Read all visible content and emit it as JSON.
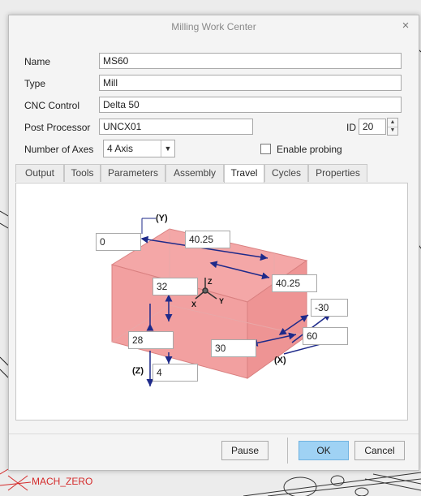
{
  "background": {
    "label": "MACH_ZERO"
  },
  "dialog": {
    "title": "Milling Work Center",
    "close": "×",
    "fields": {
      "name_label": "Name",
      "name_value": "MS60",
      "type_label": "Type",
      "type_value": "Mill",
      "cnc_label": "CNC Control",
      "cnc_value": "Delta 50",
      "post_label": "Post Processor",
      "post_value": "UNCX01",
      "id_label": "ID",
      "id_value": "20",
      "axes_label": "Number of Axes",
      "axes_value": "4 Axis",
      "probing_label": "Enable probing"
    },
    "tabs": [
      "Output",
      "Tools",
      "Parameters",
      "Assembly",
      "Travel",
      "Cycles",
      "Properties"
    ],
    "active_tab": "Travel",
    "travel": {
      "values": {
        "y_min": "0",
        "y_len": "40.25",
        "y_max": "40.25",
        "z_max": "32",
        "z_min_a": "28",
        "z_min_b": "4",
        "x_min": "-30",
        "x_max": "60",
        "x_len": "30"
      },
      "axis_labels": {
        "y": "(Y)",
        "z": "(Z)",
        "x": "(X)"
      },
      "triad": {
        "z": "Z",
        "x": "X",
        "y": "Y"
      }
    },
    "buttons": {
      "pause": "Pause",
      "ok": "OK",
      "cancel": "Cancel"
    }
  },
  "colors": {
    "ok": "#9fd2f4",
    "box_fill": "#f4a7a7",
    "arrow": "#1e2a8a"
  }
}
